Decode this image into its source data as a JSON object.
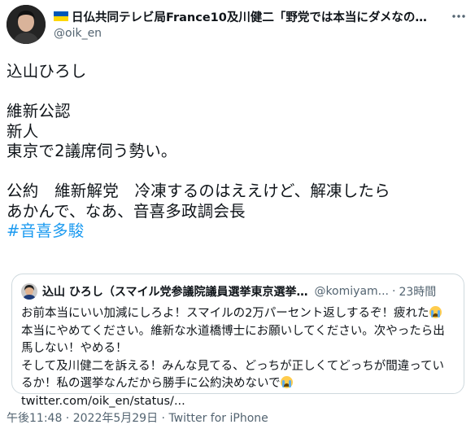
{
  "author": {
    "display_name": "日仏共同テレビ局France10及川健二「野党では本当にダメなの…",
    "handle": "@oik_en"
  },
  "tweet": {
    "line1": "込山ひろし",
    "line2": "維新公認",
    "line3": "新人",
    "line4": "東京で2議席伺う勢い。",
    "line5": "公約　維新解党　冷凍するのはええけど、解凍したら",
    "line6": "あかんで、なあ、音喜多政調会長",
    "hashtag": "#音喜多駿"
  },
  "quote": {
    "name": "込山 ひろし（スマイル党参議院議員選挙東京選挙…",
    "handle": "@komiyam...",
    "separator": "·",
    "time": "23時間",
    "line1": "お前本当にいい加減にしろよ！スマイルの2万パーセント返しするぞ！疲れた",
    "line2": "本当にやめてください。維新な水道橋博士にお願いしてください。次やったら出",
    "line3": "馬しない！やめる！",
    "line4": "そして及川健二を訴える！みんな見てる、どっちが正しくてどっちが間違ってい",
    "line5a": "るか！私の選挙なんだから勝手に公約決めないで",
    "line5b": " twitter.com/oik_en/status/..."
  },
  "meta": {
    "time": "午後11:48",
    "separator1": " · ",
    "date": "2022年5月29日",
    "separator2": " · ",
    "source": "Twitter for iPhone"
  },
  "icons": {
    "more": "more-icon",
    "flag": "ukraine-flag-icon",
    "emoji": "crying-face-emoji"
  },
  "colors": {
    "link": "#1d9bf0",
    "secondary": "#536471",
    "border": "#cfd9de"
  }
}
